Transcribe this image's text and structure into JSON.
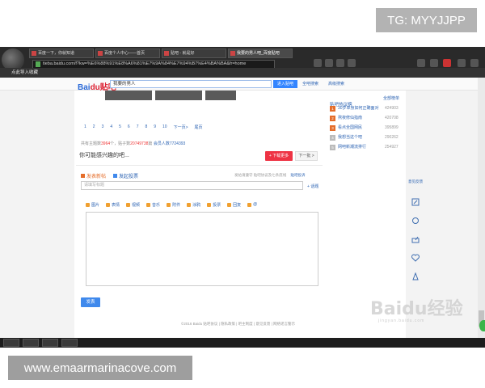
{
  "overlays": {
    "telegram_tag": "TG: MYYJJPP",
    "site_url": "www.emaarmarinacove.com"
  },
  "browser": {
    "tabs": [
      {
        "label": "百度一下，你就知道"
      },
      {
        "label": "百度个人中心——首页"
      },
      {
        "label": "贴吧 - 就是好"
      },
      {
        "label": "我要的男人吧_百度贴吧"
      }
    ],
    "address": "tieba.baidu.com/f?kw=%E6%88%91%E8%A6%81%E7%9A%84%E7%94%B7%E4%BA%BA&fr=home",
    "bookmarks_label": "点此导入收藏"
  },
  "page": {
    "logo_text": "Bai",
    "logo_accent": "du贴吧",
    "search_value": "我要的男人",
    "enter_button": "进入贴吧",
    "search_all": "全吧搜索",
    "advanced": "高级搜索",
    "pager": [
      "1",
      "2",
      "3",
      "4",
      "5",
      "6",
      "7",
      "8",
      "9",
      "10",
      "下一页>",
      "尾页"
    ],
    "stats_prefix": "共有主题数",
    "stats_topics": "3964",
    "stats_mid": "个，贴子数",
    "stats_posts": "20749738",
    "stats_suffix": "篇",
    "stats_members_prefix": "会员人数",
    "stats_members": "7724393",
    "maybe_like": "你可能感兴趣的吧...",
    "btn_like": "+ 下载更多",
    "btn_next": "下一批 >",
    "hot_title": "贴吧热议榜",
    "hot_more": "全部榜单",
    "hot_items": [
      {
        "rank": "1",
        "text": "30岁单身如何正确面对",
        "count": "424903"
      },
      {
        "rank": "2",
        "text": "熬夜修仙指南",
        "count": "420708"
      },
      {
        "rank": "3",
        "text": "看点全国网民",
        "count": "395899"
      },
      {
        "rank": "4",
        "text": "我想当这个吧",
        "count": "290262"
      },
      {
        "rank": "5",
        "text": "网吧新潮流排行",
        "count": "254927"
      }
    ],
    "tab_post": "发表新帖",
    "tab_vote": "发起投票",
    "post_hint": "发帖请遵守 贴吧协议及七条底线",
    "post_rules": "贴吧投诉",
    "title_placeholder": "请填写标题",
    "tag_link": "+ 话题",
    "tools": [
      "图片",
      "表情",
      "视频",
      "音乐",
      "附件",
      "涂鸦",
      "投票",
      "回复",
      "@"
    ],
    "send_button": "发表",
    "footer": "©2016 Baidu 贴吧协议 | 隐私政策 | 吧主制度 | 意见反馈 | 网络谣言警示",
    "sidebar_right_label": "意见反馈",
    "watermark_main": "Baidu经验",
    "watermark_sub": "jingyan.baidu.com"
  }
}
